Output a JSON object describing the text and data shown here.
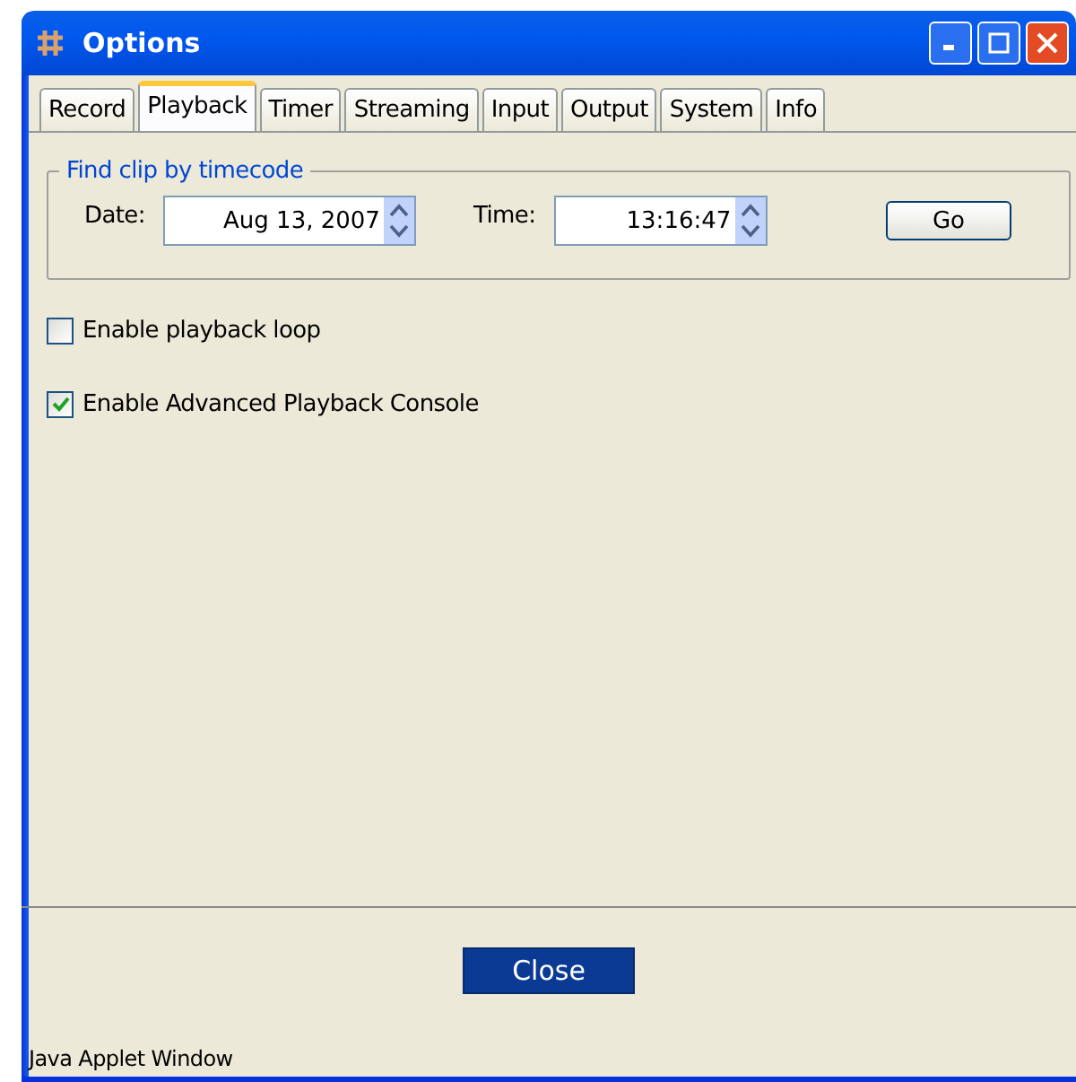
{
  "window": {
    "title": "Options"
  },
  "tabs": [
    {
      "label": "Record",
      "selected": false
    },
    {
      "label": "Playback",
      "selected": true
    },
    {
      "label": "Timer",
      "selected": false
    },
    {
      "label": "Streaming",
      "selected": false
    },
    {
      "label": "Input",
      "selected": false
    },
    {
      "label": "Output",
      "selected": false
    },
    {
      "label": "System",
      "selected": false
    },
    {
      "label": "Info",
      "selected": false
    }
  ],
  "group": {
    "title": "Find clip by timecode",
    "fields": [
      {
        "label": "Date:",
        "value": "Aug 13, 2007"
      },
      {
        "label": "Time:",
        "value": "13:16:47"
      }
    ],
    "button": "Go"
  },
  "checkboxes": [
    {
      "label": "Enable playback loop",
      "checked": false
    },
    {
      "label": "Enable Advanced Playback Console",
      "checked": true
    }
  ],
  "close_button": "Close",
  "status_bar": "Java Applet Window"
}
